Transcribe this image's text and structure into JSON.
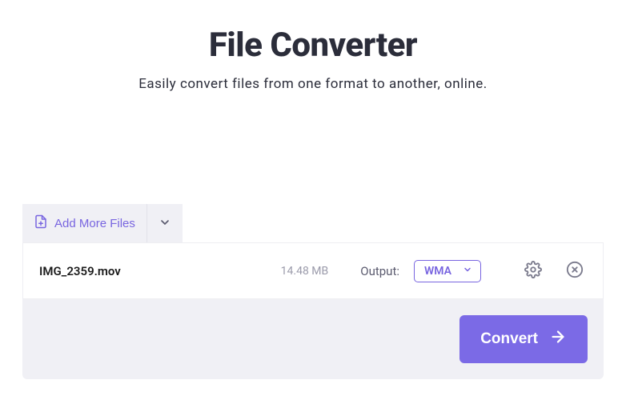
{
  "header": {
    "title": "File Converter",
    "subtitle": "Easily convert files from one format to another, online."
  },
  "toolbar": {
    "add_more_label": "Add More Files"
  },
  "file": {
    "name": "IMG_2359.mov",
    "size": "14.48 MB",
    "output_label": "Output:",
    "format": "WMA"
  },
  "actions": {
    "convert_label": "Convert"
  }
}
